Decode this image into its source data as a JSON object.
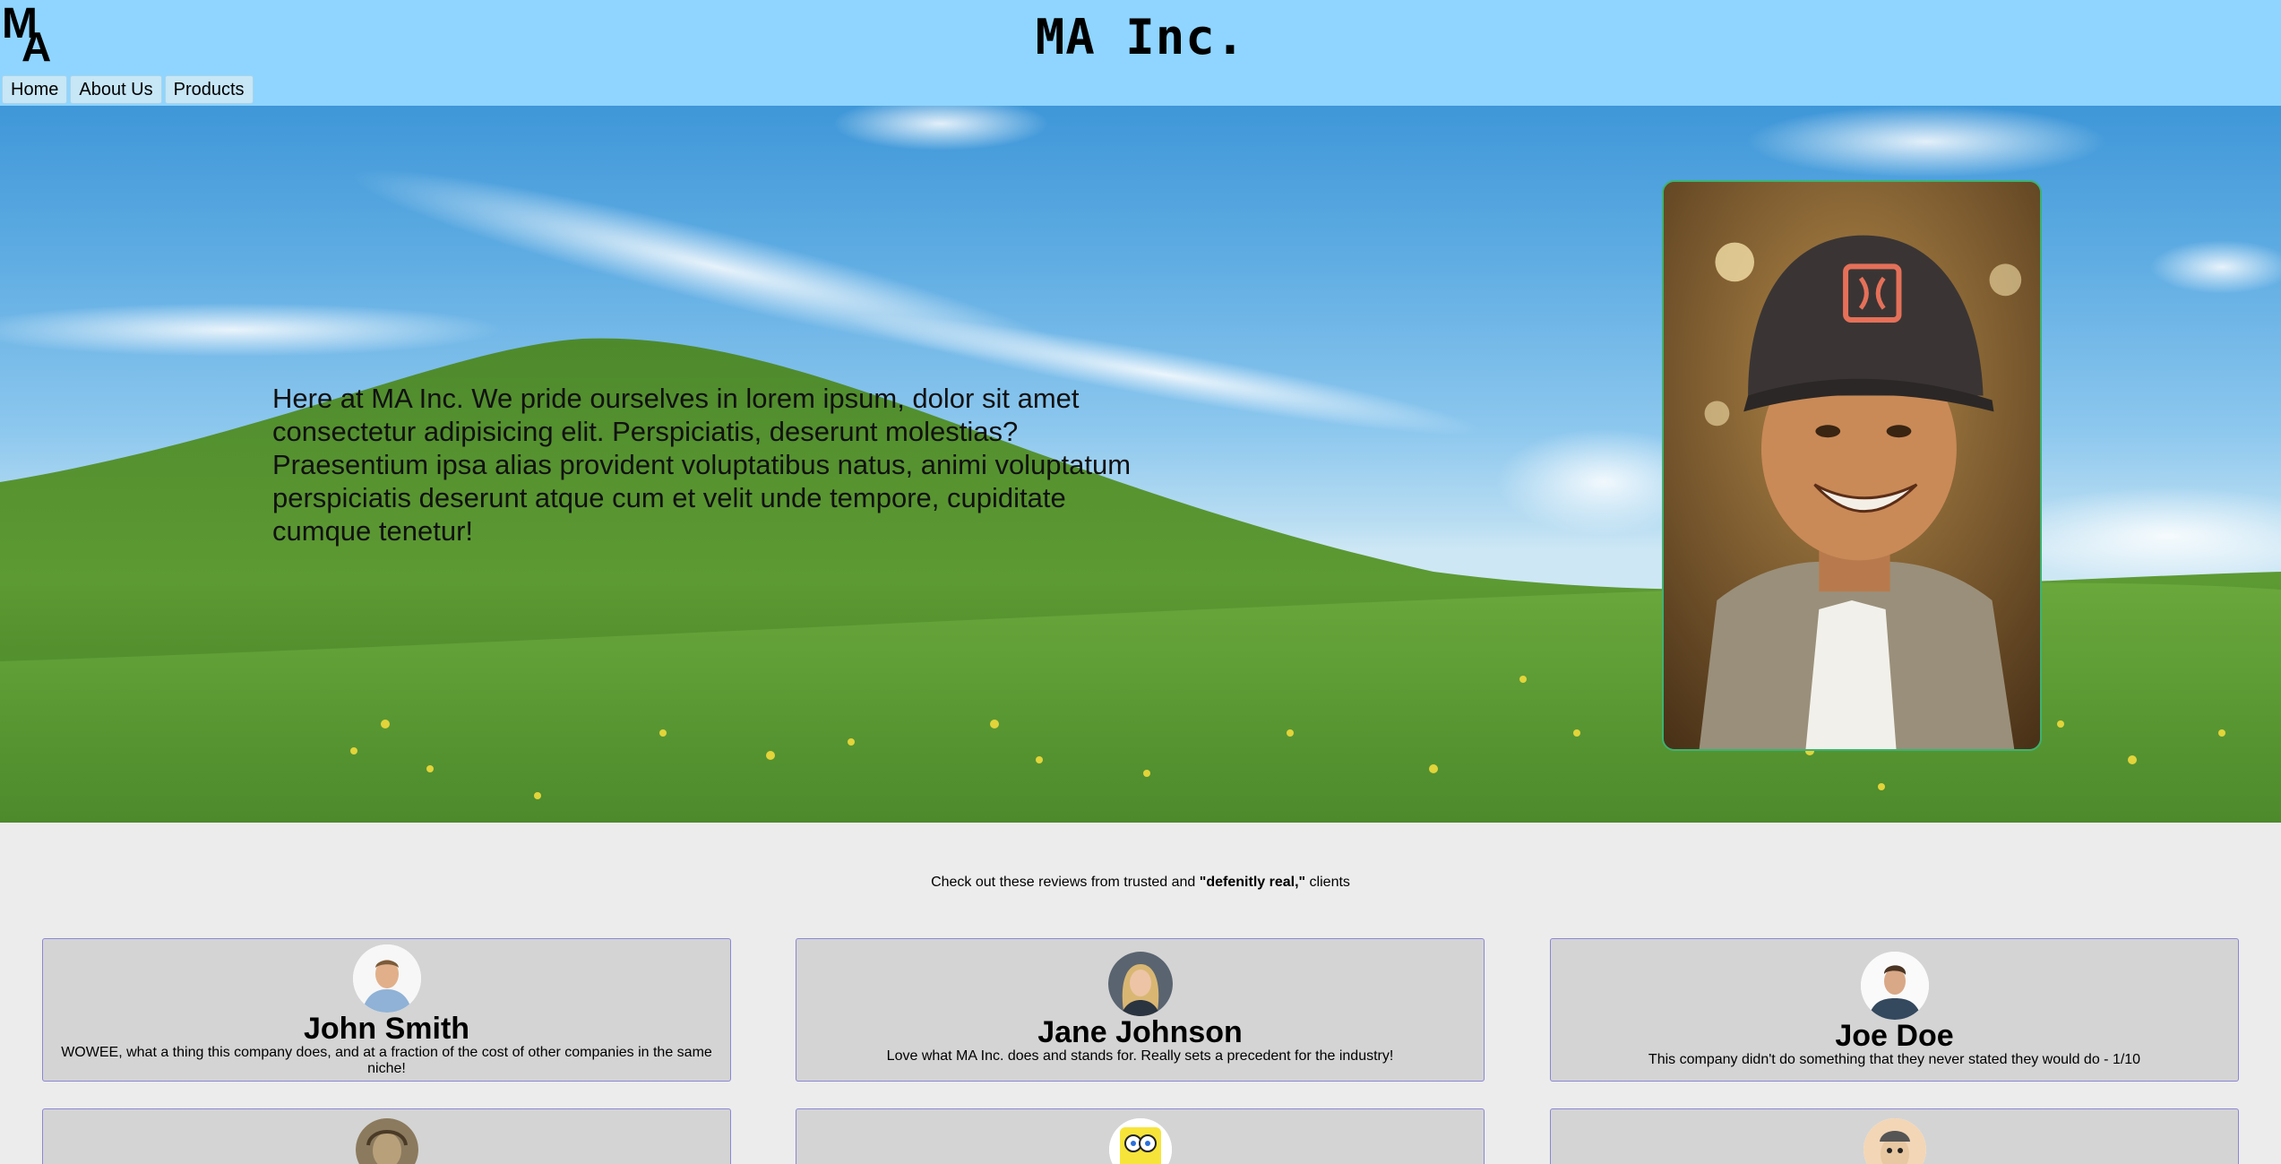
{
  "header": {
    "logo_text": "MA",
    "title": "MA Inc."
  },
  "nav": {
    "items": [
      {
        "label": "Home"
      },
      {
        "label": "About Us"
      },
      {
        "label": "Products"
      }
    ]
  },
  "hero": {
    "text": "Here at MA Inc. We pride ourselves in lorem ipsum, dolor sit amet consectetur adipisicing elit. Perspiciatis, deserunt molestias? Praesentium ipsa alias provident voluptatibus natus, animi voluptatum perspiciatis deserunt atque cum et velit unde tempore, cupiditate cumque tenetur!"
  },
  "reviews": {
    "intro_before": "Check out these reviews from trusted and ",
    "intro_bold": "\"defenitly real,\"",
    "intro_after": " clients",
    "cards": [
      {
        "name": "John Smith",
        "quote": "WOWEE, what a thing this company does, and at a fraction of the cost of other companies in the same niche!"
      },
      {
        "name": "Jane Johnson",
        "quote": "Love what MA Inc. does and stands for. Really sets a precedent for the industry!"
      },
      {
        "name": "Joe Doe",
        "quote": "This company didn't do something that they never stated they would do - 1/10"
      }
    ]
  },
  "colors": {
    "header_bg": "#8fd5ff",
    "nav_item_bg": "#c7e6f6",
    "portrait_border": "#3cb371",
    "card_border": "#8a87d6",
    "card_bg": "#d4d4d4",
    "page_bg": "#ececec"
  }
}
